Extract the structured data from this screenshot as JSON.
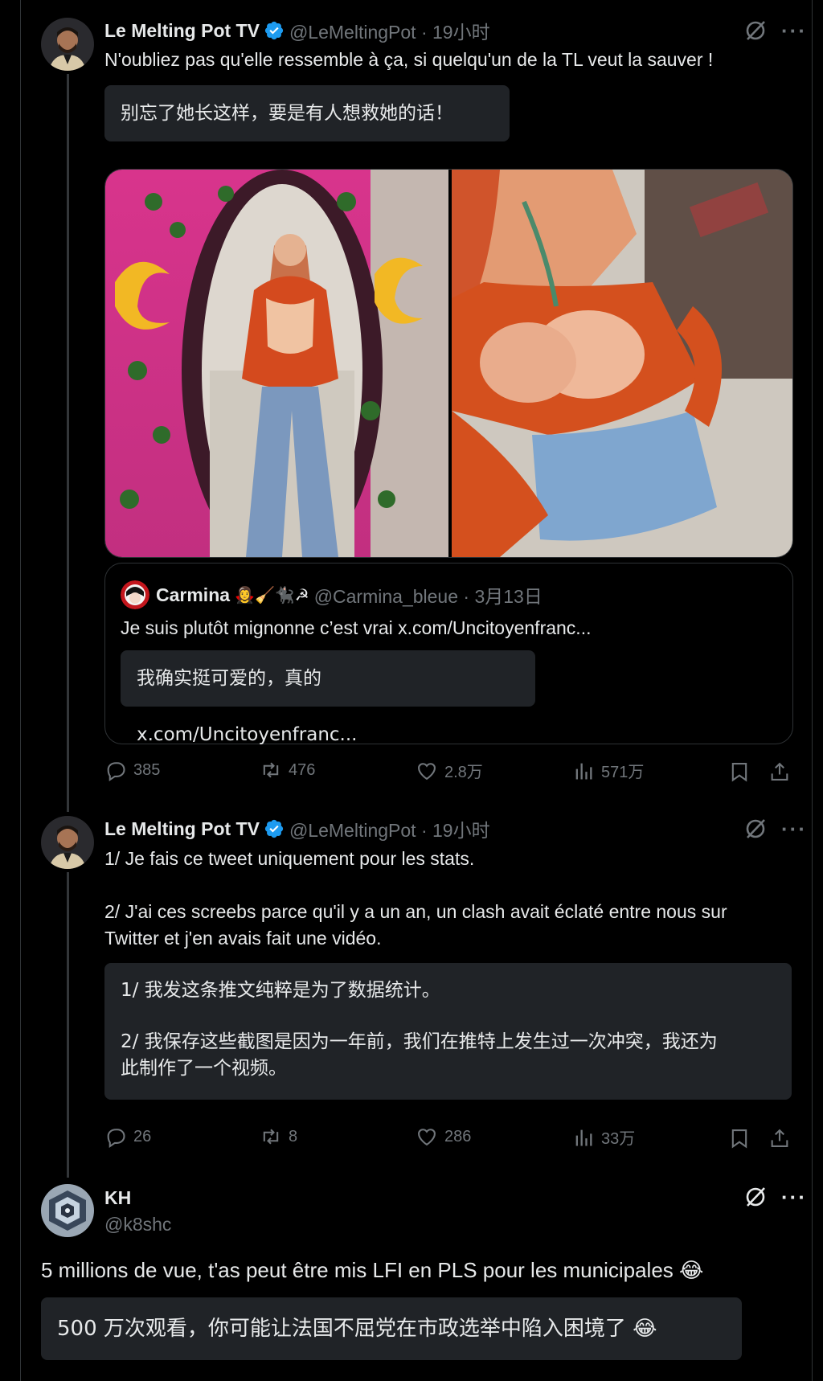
{
  "tweet1": {
    "name": "Le Melting Pot TV",
    "handle_time": "@LeMeltingPot · 19小时",
    "text": "N'oubliez pas qu'elle ressemble à ça, si quelqu'un de la TL veut la sauver !",
    "translation": "别忘了她长这样，要是有人想救她的话！",
    "quote": {
      "name": "Carmina",
      "emojis": "🧛‍♀️🧹🐈‍⬛☭",
      "handle_time": "@Carmina_bleue · 3月13日",
      "text": "Je suis plutôt mignonne c’est vrai x.com/Uncitoyenfranc...",
      "translation": "我确实挺可爱的，真的 x.com/Uncitoyenfranc..."
    },
    "stats": {
      "replies": "385",
      "retweets": "476",
      "likes": "2.8万",
      "views": "571万"
    }
  },
  "tweet2": {
    "name": "Le Melting Pot TV",
    "handle_time": "@LeMeltingPot · 19小时",
    "text_line1": "1/ Je fais ce tweet uniquement pour les stats.",
    "text_line2": "2/ J'ai ces screebs parce qu'il y a un an, un clash avait éclaté entre nous sur",
    "text_line3": "Twitter et j'en avais fait une vidéo.",
    "translation_line1": "1/ 我发这条推文纯粹是为了数据统计。",
    "translation_line2": "2/ 我保存这些截图是因为一年前，我们在推特上发生过一次冲突，我还为",
    "translation_line3": "此制作了一个视频。",
    "stats": {
      "replies": "26",
      "retweets": "8",
      "likes": "286",
      "views": "33万"
    }
  },
  "tweet3": {
    "name": "KH",
    "handle": "@k8shc",
    "text": "5 millions de vue, t'as peut être mis LFI en PLS pour les municipales 😂",
    "translation": "500 万次观看，你可能让法国不屈党在市政选举中陷入困境了 😂"
  },
  "colors": {
    "background": "#000000",
    "text": "#e7e9ea",
    "muted": "#71767b",
    "verified": "#1d9bf0",
    "translation_bg": "#202327"
  },
  "icons": [
    "verified-icon",
    "grok-icon",
    "more-icon",
    "reply-icon",
    "retweet-icon",
    "like-icon",
    "views-icon",
    "bookmark-icon",
    "share-icon"
  ]
}
